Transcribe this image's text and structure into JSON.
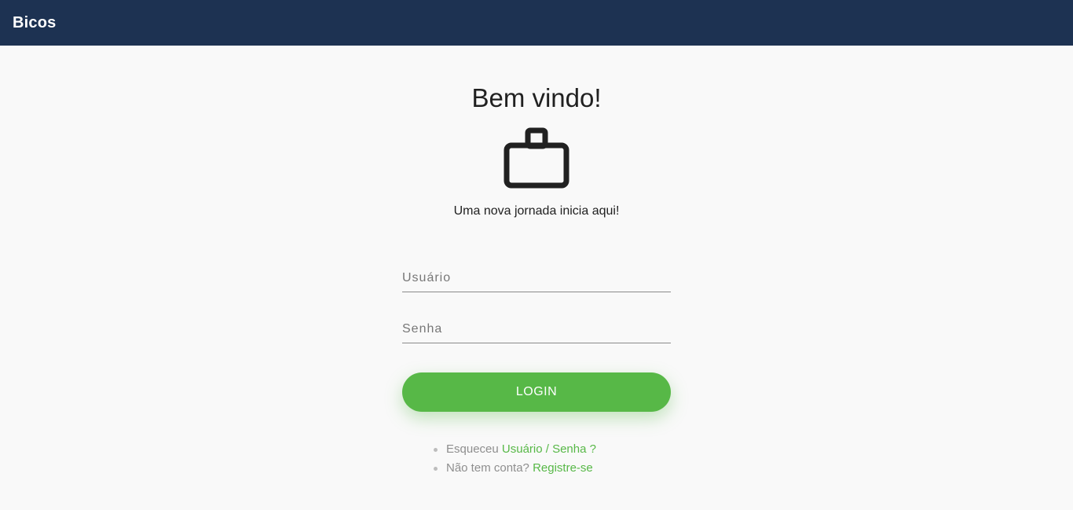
{
  "header": {
    "brand": "Bicos",
    "color": "#1d3252"
  },
  "main": {
    "title": "Bem vindo!",
    "icon": "briefcase-icon",
    "subtitle": "Uma nova jornada inicia aqui!"
  },
  "form": {
    "username_placeholder": "Usuário",
    "username_value": "",
    "password_placeholder": "Senha",
    "password_value": "",
    "login_label": "LOGIN",
    "accent_color": "#57b847"
  },
  "links": {
    "forgot_prefix": "Esqueceu ",
    "forgot_link": "Usuário / Senha ?",
    "register_prefix": "Não tem conta? ",
    "register_link": "Registre-se"
  }
}
